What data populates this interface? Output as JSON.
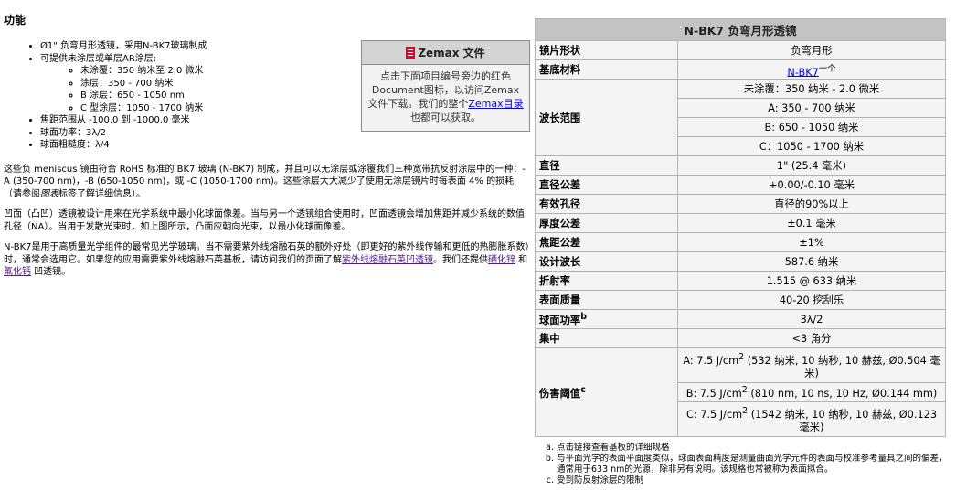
{
  "features": {
    "heading": "功能",
    "items": [
      "Ø1\" 负弯月形透镜，采用N-BK7玻璃制成",
      "可提供未涂层或单层AR涂层:",
      "焦距范围从 -100.0 到 -1000.0 毫米",
      "球面功率：3λ/2",
      "球面粗糙度：λ/4"
    ],
    "subitems": [
      "未涂覆：350 纳米至 2.0 微米",
      "涂层：350 - 700 纳米",
      "B 涂层：650 - 1050 nm",
      "C 型涂层：1050 - 1700 纳米"
    ]
  },
  "paragraphs": {
    "p1": "这些负 meniscus 镜由符合 RoHS 标准的 BK7 玻璃 (N-BK7) 制成，并且可以无涂层或涂覆我们三种宽带抗反射涂层中的一种：-A (350-700 nm)，-B (650-1050 nm)，或 -C (1050-1700 nm)。这些涂层大大减少了使用无涂层镜片时每表面 4% 的损耗（请参阅",
    "p1_em": "图表",
    "p1_end": "标签了解详细信息）。",
    "p2": "凹面（凸凹）透镜被设计用来在光学系统中最小化球面像差。当与另一个透镜组合使用时，凹面透镜会增加焦距并减少系统的数值孔径（NA）。当用于发散光束时，如上图所示，凸面应朝向光束，以最小化球面像差。",
    "p3_a": "N-BK7是用于高质量光学组件的最常见光学玻璃。当不需要紫外线熔融石英的额外好处（即更好的紫外线传输和更低的热膨胀系数）时，通常会选用它。如果您的应用需要紫外线熔融石英基板，请访问我们的页面了解",
    "p3_link1": "紫外线熔融石英凹透镜",
    "p3_b": "。我们还提供",
    "p3_link2": "硒化锌",
    "p3_c": " 和",
    "p3_link3": "氟化钙",
    "p3_d": " 凹透镜。"
  },
  "zemax": {
    "title": "Zemax 文件",
    "body_a": "点击下面项目编号旁边的红色 Document图标，以访问Zemax文件下载。我们的整个",
    "link": "Zemax目录",
    "body_b": "也都可以获取。"
  },
  "spec": {
    "title": "N-BK7 负弯月形透镜",
    "rows": {
      "shape_label": "镜片形状",
      "shape_value": "负弯月形",
      "material_label": "基底材料",
      "material_link": "N-BK7",
      "material_suffix": "一个",
      "wavelength_label": "波长范围",
      "wl_uncoated": "未涂覆：350 纳米 - 2.0 微米",
      "wl_a": "A: 350 - 700 纳米",
      "wl_b": "B: 650 - 1050 纳米",
      "wl_c": "C：1050 - 1700 纳米",
      "diameter_label": "直径",
      "diameter_value": "1\" (25.4 毫米)",
      "diam_tol_label": "直径公差",
      "diam_tol_value": "+0.00/-0.10 毫米",
      "aperture_label": "有效孔径",
      "aperture_value": "直径的90%以上",
      "thick_tol_label": "厚度公差",
      "thick_tol_value": "±0.1 毫米",
      "focal_tol_label": "焦距公差",
      "focal_tol_value": "±1%",
      "design_wl_label": "设计波长",
      "design_wl_value": "587.6 纳米",
      "index_label": "折射率",
      "index_value": "1.515 @ 633 纳米",
      "surface_label": "表面质量",
      "surface_value": "40-20 挖刮乐",
      "power_label": "球面功率",
      "power_sup": "b",
      "power_value": "3λ/2",
      "centration_label": "集中",
      "centration_value": "<3 角分",
      "damage_label": "伤害阈值",
      "damage_sup": "c",
      "dmg_a_pre": "A: 7.5 J/cm",
      "dmg_a_post": " (532 纳米, 10 纳秒, 10 赫兹, Ø0.504 毫米)",
      "dmg_b_pre": "B: 7.5 J/cm",
      "dmg_b_post": " (810 nm, 10 ns, 10 Hz, Ø0.144 mm)",
      "dmg_c_pre": "C: 7.5 J/cm",
      "dmg_c_post": " (1542 纳米, 10 纳秒, 10 赫兹, Ø0.123 毫米)",
      "sq": "2"
    }
  },
  "footnotes": [
    "点击链接查看基板的详细规格",
    "与平面光学的表面平面度类似，球面表面精度是测量曲面光学元件的表面与校准参考量具之间的偏差，通常用于633 nm的光源，除非另有说明。该规格也常被称为表面拟合。",
    "受到防反射涂层的限制"
  ]
}
